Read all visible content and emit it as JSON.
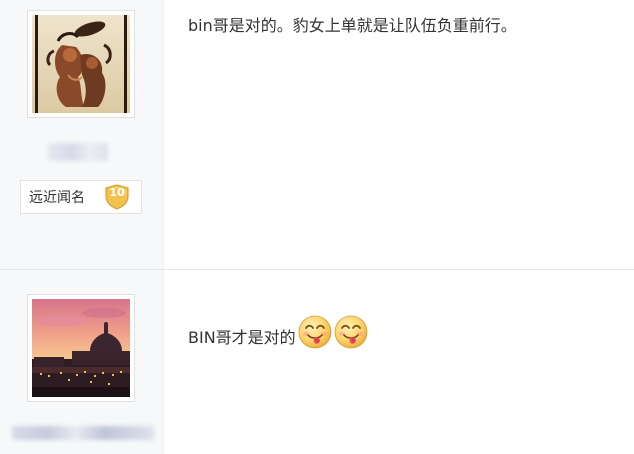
{
  "posts": [
    {
      "content": "bin哥是对的。豹女上单就是让队伍负重前行。",
      "level": {
        "title": "远近闻名",
        "number": "10"
      }
    },
    {
      "content": "BIN哥才是对的",
      "emoji_icons": [
        "tongue-out-emoji-icon",
        "tongue-out-emoji-icon"
      ]
    }
  ],
  "colors": {
    "user_column_bg": "#f7f8fa",
    "text": "#333333",
    "badge_gold": "#f2c14e",
    "divider": "#e6e6e6"
  }
}
